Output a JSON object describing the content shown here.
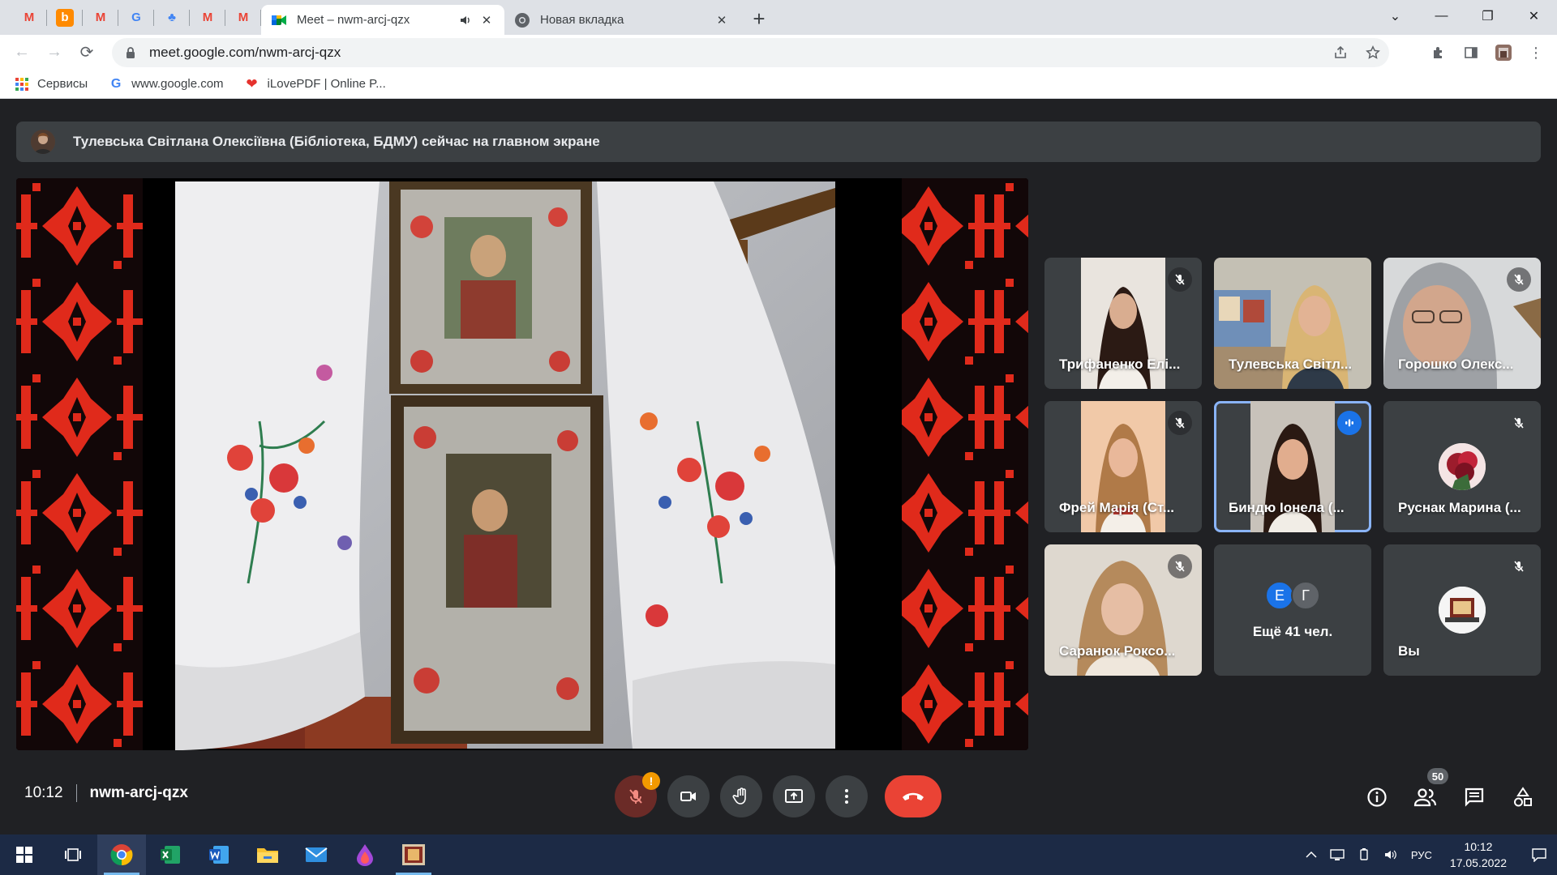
{
  "browser": {
    "pinned_tabs": [
      {
        "icon": "gmail-icon",
        "glyph": "M",
        "color": "#ea4335"
      },
      {
        "icon": "blogger-icon",
        "glyph": "b",
        "color": "#ff8a00"
      },
      {
        "icon": "gmail-icon",
        "glyph": "M",
        "color": "#ea4335"
      },
      {
        "icon": "translate-icon",
        "glyph": "G",
        "color": "#4285f4"
      },
      {
        "icon": "sitemap-icon",
        "glyph": "♣",
        "color": "#4285f4"
      },
      {
        "icon": "gmail-icon",
        "glyph": "M",
        "color": "#ea4335"
      },
      {
        "icon": "gmail-icon",
        "glyph": "M",
        "color": "#ea4335"
      }
    ],
    "active_tab": {
      "title": "Meet – nwm-arcj-qzx"
    },
    "other_tab": {
      "title": "Новая вкладка"
    },
    "url": "meet.google.com/nwm-arcj-qzx",
    "bookmarks": [
      {
        "label": "Сервисы",
        "icon": "apps-grid-icon"
      },
      {
        "label": "www.google.com",
        "icon": "google-icon"
      },
      {
        "label": "iLovePDF | Online P...",
        "icon": "heart-icon"
      }
    ]
  },
  "meet": {
    "presenter_banner": "Тулевська Світлана Олексіївна (Бібліотека, БДМУ) сейчас на главном экране",
    "participants": [
      {
        "name": "Трифаненко Елі...",
        "muted": true,
        "speaking": false
      },
      {
        "name": "Тулевська Світл...",
        "muted": false,
        "speaking": false
      },
      {
        "name": "Горошко Олекс...",
        "muted": true,
        "speaking": false
      },
      {
        "name": "Фрей Марія (Ст...",
        "muted": true,
        "speaking": false
      },
      {
        "name": "Биндю Іонела (...",
        "muted": false,
        "speaking": true
      },
      {
        "name": "Руснак Марина (...",
        "muted": true,
        "speaking": false
      },
      {
        "name": "Саранюк Роксо...",
        "muted": true,
        "speaking": false
      },
      {
        "name": "Ещё 41 чел.",
        "muted": false,
        "speaking": false,
        "initials": [
          "Е",
          "Г"
        ]
      },
      {
        "name": "Вы",
        "muted": true,
        "speaking": false
      }
    ],
    "time": "10:12",
    "meeting_code": "nwm-arcj-qzx",
    "mic_warning": "!",
    "people_count": "50",
    "colors": {
      "accent": "#8ab4f8",
      "hangup": "#ea4335",
      "warning": "#f29900"
    }
  },
  "taskbar": {
    "language": "РУС",
    "time": "10:12",
    "date": "17.05.2022"
  }
}
